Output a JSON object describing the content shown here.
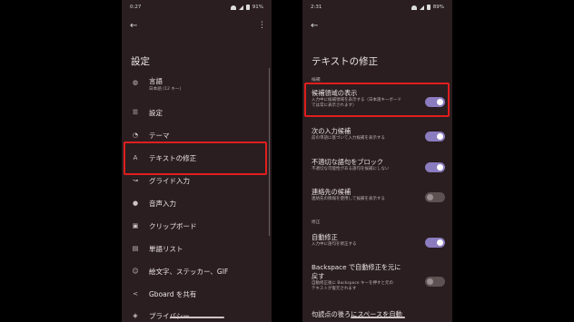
{
  "left": {
    "status_time": "0:27",
    "status_battery": "91%",
    "title": "設定",
    "items": [
      {
        "label": "言語",
        "sub": "日本語 (12 キー)",
        "icon": "globe-icon"
      },
      {
        "label": "設定",
        "sub": "",
        "icon": "sliders-icon"
      },
      {
        "label": "テーマ",
        "sub": "",
        "icon": "palette-icon"
      },
      {
        "label": "テキストの修正",
        "sub": "",
        "icon": "text-correction-icon"
      },
      {
        "label": "グライド入力",
        "sub": "",
        "icon": "glide-icon"
      },
      {
        "label": "音声入力",
        "sub": "",
        "icon": "mic-icon"
      },
      {
        "label": "クリップボード",
        "sub": "",
        "icon": "clipboard-icon"
      },
      {
        "label": "単語リスト",
        "sub": "",
        "icon": "book-icon"
      },
      {
        "label": "絵文字、ステッカー、GIF",
        "sub": "",
        "icon": "emoji-icon"
      },
      {
        "label": "Gboard を共有",
        "sub": "",
        "icon": "share-icon"
      },
      {
        "label": "プライバシー",
        "sub": "",
        "icon": "shield-icon"
      }
    ]
  },
  "right": {
    "status_time": "2:31",
    "status_battery": "89%",
    "title": "テキストの修正",
    "section_suggest": "候補",
    "section_correct": "修正",
    "items": [
      {
        "label": "候補領域の表示",
        "sub": "入力中に候補領域を表示する（日本語キーボード",
        "sub2": "では常に表示されます）",
        "on": true
      },
      {
        "label": "次の入力候補",
        "sub": "前の単語に基づいて入力候補を表示する",
        "sub2": "",
        "on": true
      },
      {
        "label": "不適切な語句をブロック",
        "sub": "不適切な可能性がある語句を候補にしない",
        "sub2": "",
        "on": true
      },
      {
        "label": "連絡先の候補",
        "sub": "連絡先の情報を使用して候補を表示する",
        "sub2": "",
        "on": false
      },
      {
        "label": "自動修正",
        "sub": "入力中に語句を修正する",
        "sub2": "",
        "on": true
      },
      {
        "label": "Backspace で自動修正を元に",
        "label2": "戻す",
        "sub": "自動修正後に Backspace キーを押すと元の",
        "sub2": "テキストが復元されます",
        "on": false
      },
      {
        "label": "句読点の後ろにスペースを自動",
        "sub": "",
        "sub2": "",
        "on": null
      }
    ]
  },
  "colors": {
    "panel_bg": "#2a1e20",
    "toggle_on": "#8b7bbf",
    "toggle_off": "#5e5152",
    "highlight": "#e01e1e"
  }
}
